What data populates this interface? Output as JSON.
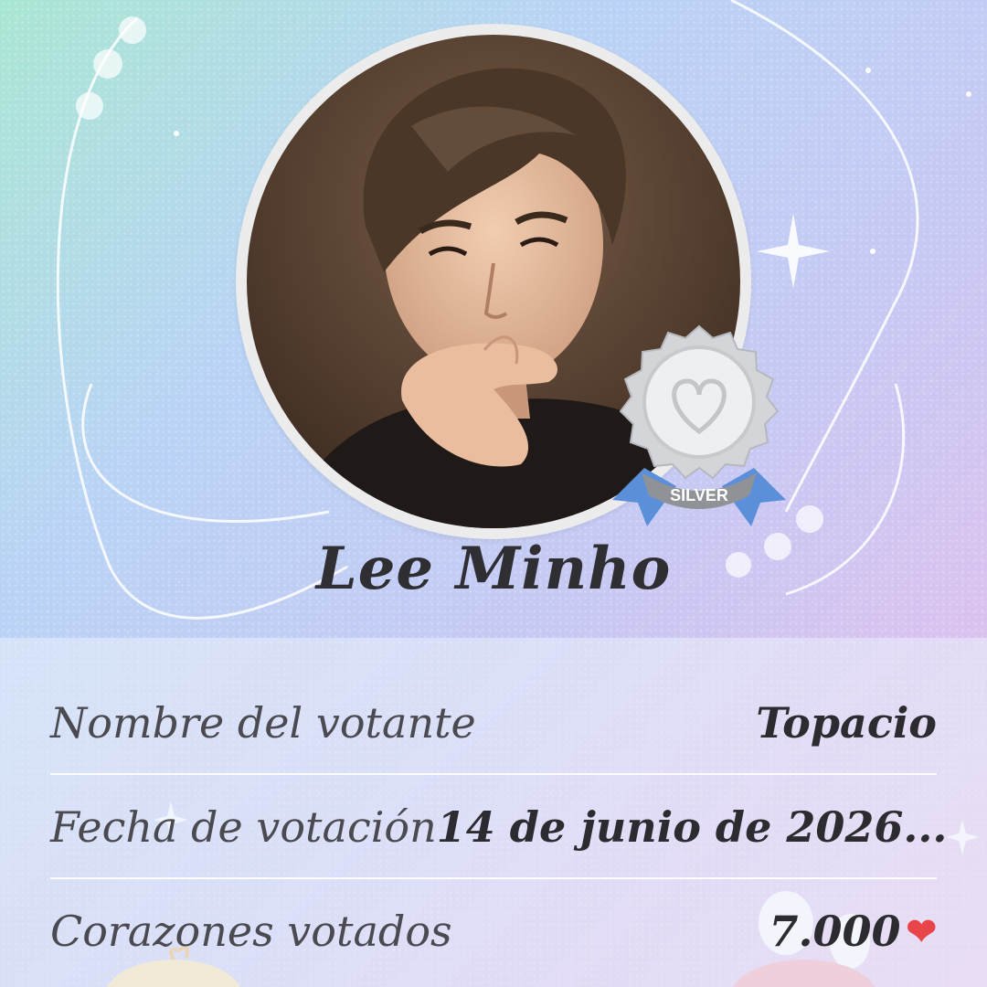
{
  "profile": {
    "name": "Lee Minho",
    "badge_label": "SILVER"
  },
  "details": [
    {
      "label": "Nombre del votante",
      "value": "Topacio"
    },
    {
      "label": "Fecha de votación",
      "value": "14 de junio de 2026..."
    },
    {
      "label": "Corazones votados",
      "value": "7.000"
    }
  ],
  "icons": {
    "heart": "heart-icon",
    "moon": "moon-icon",
    "sparkle": "sparkle-icon"
  },
  "colors": {
    "heart": "#e8454a",
    "ribbon": "#5b8fd9",
    "medal": "#c9cbcf"
  }
}
